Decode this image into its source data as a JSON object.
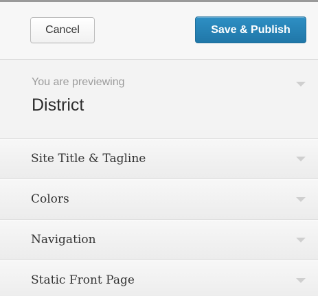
{
  "header": {
    "cancel_label": "Cancel",
    "publish_label": "Save & Publish"
  },
  "preview": {
    "label": "You are previewing",
    "theme_name": "District"
  },
  "sections": [
    {
      "label": "Site Title & Tagline"
    },
    {
      "label": "Colors"
    },
    {
      "label": "Navigation"
    },
    {
      "label": "Static Front Page"
    }
  ],
  "colors": {
    "publish_button": "#2a84b8",
    "background": "#f5f5f5",
    "caret": "#cfcfcf"
  },
  "icons": {
    "expand": "chevron-down-icon"
  }
}
